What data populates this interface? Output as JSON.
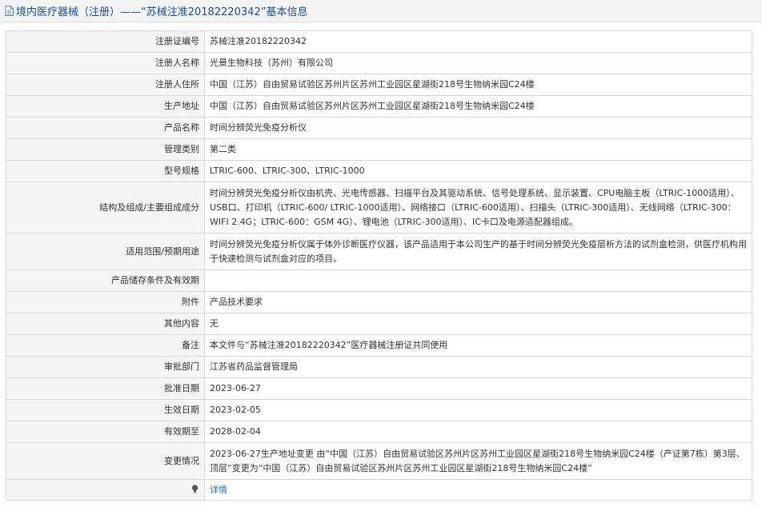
{
  "header": {
    "title": "境内医疗器械（注册）——“苏械注准20182220342”基本信息",
    "icon": "document-icon"
  },
  "rows": [
    {
      "label": "注册证编号",
      "value": "苏械注准20182220342"
    },
    {
      "label": "注册人名称",
      "value": "光景生物科技（苏州）有限公司"
    },
    {
      "label": "注册人住所",
      "value": "中国（江苏）自由贸易试验区苏州片区苏州工业园区星湖街218号生物纳米园C24楼"
    },
    {
      "label": "生产地址",
      "value": "中国（江苏）自由贸易试验区苏州片区苏州工业园区星湖街218号生物纳米园C24楼"
    },
    {
      "label": "产品名称",
      "value": "时间分辨荧光免疫分析仪"
    },
    {
      "label": "管理类别",
      "value": "第二类"
    },
    {
      "label": "型号规格",
      "value": "LTRIC-600、LTRIC-300、LTRIC-1000"
    },
    {
      "label": "结构及组成/主要组成成分",
      "value": "时间分辨荧光免疫分析仪由机壳、光电传感器、扫描平台及其驱动系统、信号处理系统、显示装置、CPU电脑主板（LTRIC-1000适用）、USB口、打印机（LTRIC-600/ LTRIC-1000适用）、网络接口（LTRIC-600适用）、扫描头（LTRIC-300适用）、无线网络（LTRIC-300：WIFI 2.4G；LTRIC-600：GSM 4G）、锂电池（LTRIC-300适用）、IC卡口及电源适配器组成。"
    },
    {
      "label": "适用范围/预期用途",
      "value": "时间分辨荧光免疫分析仪属于体外诊断医疗仪器，该产品适用于本公司生产的基于时间分辨荧光免疫层析方法的试剂盒检测，供医疗机构用于快速检测与试剂盒对应的项目。"
    },
    {
      "label": "产品储存条件及有效期",
      "value": ""
    },
    {
      "label": "附件",
      "value": "产品技术要求"
    },
    {
      "label": "其他内容",
      "value": "无"
    },
    {
      "label": "备注",
      "value": "本文件与“苏械注准20182220342”医疗器械注册证共同使用"
    },
    {
      "label": "审批部门",
      "value": "江苏省药品监督管理局"
    },
    {
      "label": "批准日期",
      "value": "2023-06-27"
    },
    {
      "label": "生效日期",
      "value": "2023-02-05"
    },
    {
      "label": "有效期至",
      "value": "2028-02-04"
    },
    {
      "label": "变更情况",
      "value": "2023-06-27生产地址变更 由“中国（江苏）自由贸易试验区苏州片区苏州工业园区星湖街218号生物纳米园C24楼（产证第7栋）第3层、顶层”变更为“中国（江苏）自由贸易试验区苏州片区苏州工业园区星湖街218号生物纳米园C24楼”"
    }
  ],
  "detail": {
    "icon": "lightbulb-icon",
    "link": "详情"
  }
}
